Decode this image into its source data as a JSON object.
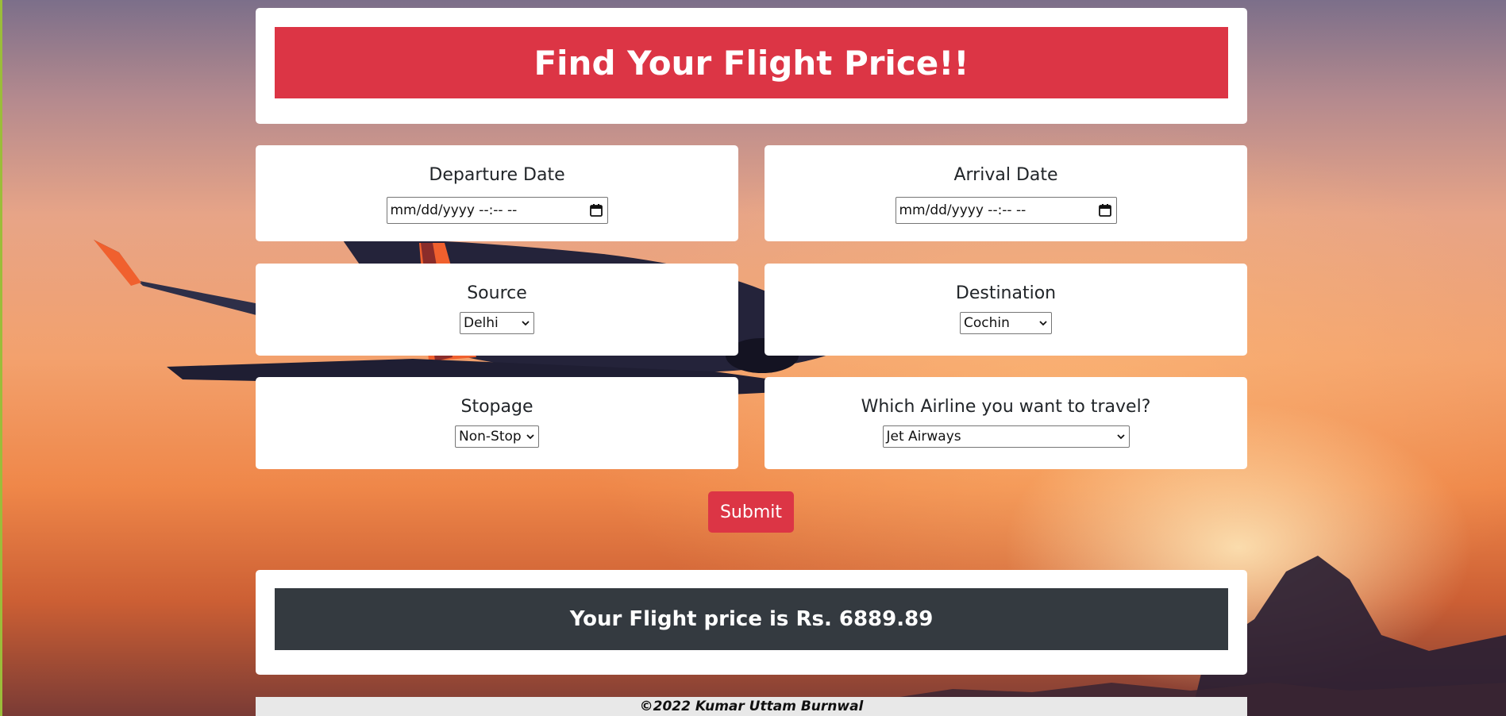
{
  "header": {
    "title": "Find Your Flight Price!!"
  },
  "form": {
    "departure": {
      "label": "Departure Date",
      "value": "mm/dd/yyyy --:-- --"
    },
    "arrival": {
      "label": "Arrival Date",
      "value": "mm/dd/yyyy --:-- --"
    },
    "source": {
      "label": "Source",
      "selected": "Delhi"
    },
    "destination": {
      "label": "Destination",
      "selected": "Cochin"
    },
    "stopage": {
      "label": "Stopage",
      "selected": "Non-Stop"
    },
    "airline": {
      "label": "Which Airline you want to travel?",
      "selected": "Jet Airways"
    },
    "submit_label": "Submit"
  },
  "result": {
    "text": "Your Flight price is Rs. 6889.89"
  },
  "footer": {
    "text": "©2022 Kumar Uttam Burnwal"
  },
  "icons": {
    "date": "calendar-icon",
    "select": "chevron-down-icon"
  },
  "colors": {
    "accent": "#dc3545",
    "result_bar": "#343a40",
    "footer_bg": "#e8e8e8"
  }
}
